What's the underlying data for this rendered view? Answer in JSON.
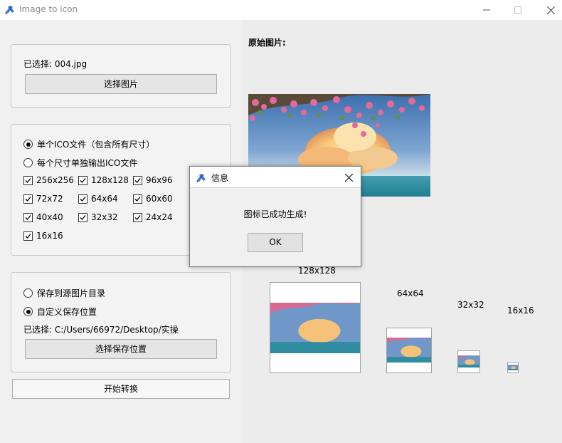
{
  "window": {
    "title": "Image to icon",
    "logo_icon": "pen-ruler-icon",
    "accent_color": "#3b78e7"
  },
  "source_group": {
    "selected_label": "已选择: 004.jpg",
    "select_button": "选择图片"
  },
  "output_group": {
    "mode_single": "单个ICO文件（包含所有尺寸）",
    "mode_separate": "每个尺寸单独输出ICO文件",
    "selected_mode": "single",
    "sizes": [
      {
        "label": "256x256",
        "checked": true
      },
      {
        "label": "128x128",
        "checked": true
      },
      {
        "label": "96x96",
        "checked": true
      },
      {
        "label": "72x72",
        "checked": true
      },
      {
        "label": "64x64",
        "checked": true
      },
      {
        "label": "60x60",
        "checked": true
      },
      {
        "label": "40x40",
        "checked": true
      },
      {
        "label": "32x32",
        "checked": true
      },
      {
        "label": "24x24",
        "checked": true
      },
      {
        "label": "16x16",
        "checked": true
      }
    ]
  },
  "save_group": {
    "option_source_dir": "保存到源图片目录",
    "option_custom": "自定义保存位置",
    "selected_option": "custom",
    "selected_path": "已选择: C:/Users/66972/Desktop/实操",
    "select_button": "选择保存位置"
  },
  "convert_button": "开始转换",
  "preview": {
    "original_title": "原始图片:",
    "labels": [
      "128x128",
      "64x64",
      "32x32",
      "16x16"
    ]
  },
  "dialog": {
    "title": "信息",
    "message": "图标已成功生成!",
    "ok_label": "OK"
  }
}
